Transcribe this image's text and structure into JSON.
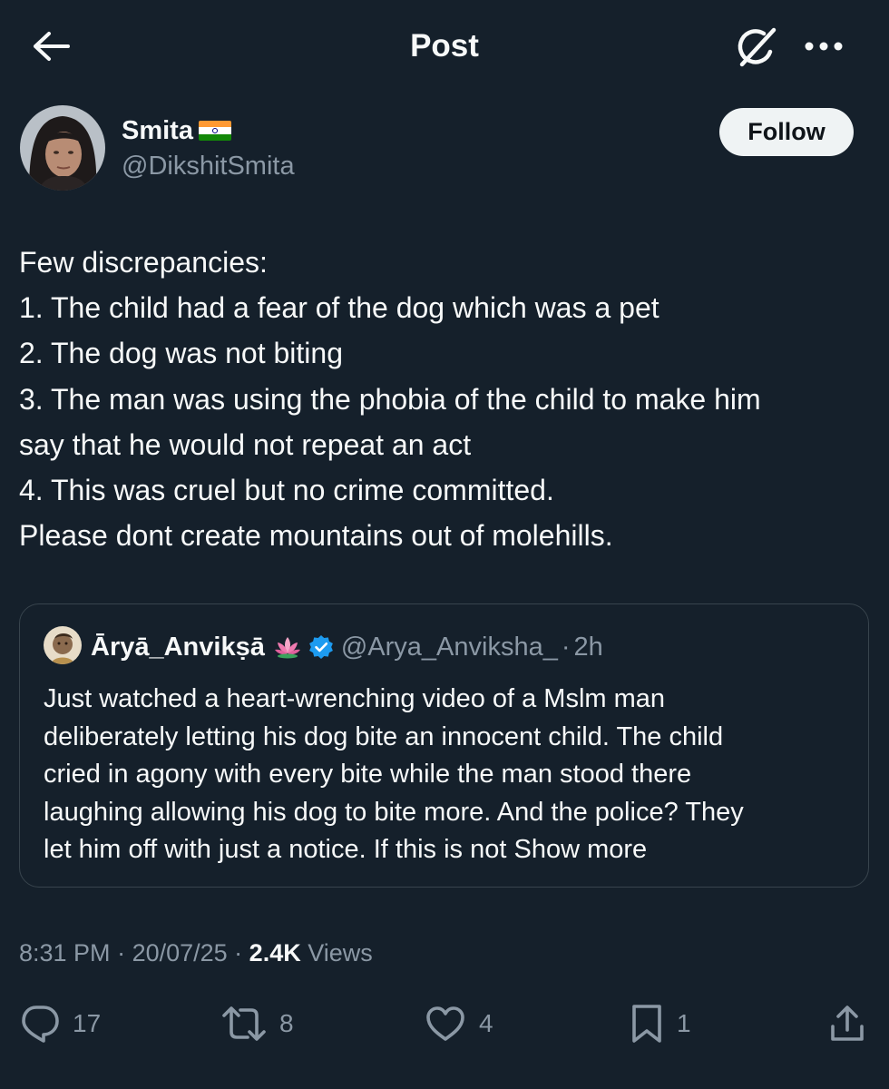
{
  "header": {
    "title": "Post"
  },
  "author": {
    "name": "Smita",
    "flag_emoji": "🇮🇳",
    "handle": "@DikshitSmita",
    "follow_label": "Follow"
  },
  "post": {
    "lines": [
      "Few discrepancies:",
      "1. The child had a fear of the dog which was a pet",
      "2. The dog was not biting",
      "3. The man was using the phobia of the child to make him",
      "say that he would not repeat an act",
      "4. This was cruel but no crime committed.",
      "Please dont create mountains out of molehills."
    ]
  },
  "quote": {
    "name": "Āryā_Anvikṣā",
    "name_emoji": "🪷",
    "handle": "@Arya_Anviksha_",
    "separator": "·",
    "time": "2h",
    "lines": [
      "Just watched a heart-wrenching video of a Mslm man",
      "deliberately letting his dog bite an innocent child. The child",
      "cried in agony with every bite while the man stood there",
      "laughing allowing his dog to bite more. And the police? They",
      "let him off with just a notice. If this is not "
    ],
    "show_more": "Show more"
  },
  "meta": {
    "time": "8:31 PM",
    "sep": " · ",
    "date": "20/07/25",
    "views_count": "2.4K",
    "views_label": " Views"
  },
  "actions": {
    "replies": "17",
    "reposts": "8",
    "likes": "4",
    "bookmarks": "1"
  },
  "icons": {
    "back": "arrow-left-icon",
    "grok": "grok-icon",
    "more": "more-horizontal-icon",
    "verified": "verified-badge-icon",
    "reply": "reply-icon",
    "repost": "repost-icon",
    "like": "heart-icon",
    "bookmark": "bookmark-icon",
    "share": "share-icon"
  },
  "colors": {
    "background": "#15202b",
    "text": "#f7f9f9",
    "muted": "#8b98a5",
    "border": "#38444d",
    "verified": "#1d9bf0",
    "follow_bg": "#eff3f4"
  }
}
